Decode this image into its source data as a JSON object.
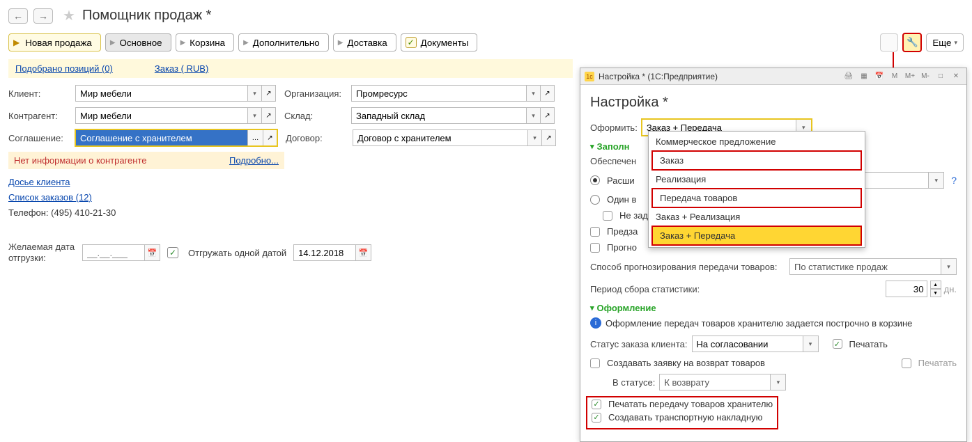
{
  "page": {
    "title": "Помощник продаж *"
  },
  "tabs": {
    "new_sale": "Новая продажа",
    "main": "Основное",
    "cart": "Корзина",
    "extra": "Дополнительно",
    "delivery": "Доставка",
    "docs": "Документы",
    "more": "Еще"
  },
  "info_strip": {
    "positions": "Подобрано позиций (0)",
    "order": "Заказ ( RUB)"
  },
  "form": {
    "client_lbl": "Клиент:",
    "client_val": "Мир мебели",
    "contr_lbl": "Контрагент:",
    "contr_val": "Мир мебели",
    "agr_lbl": "Соглашение:",
    "agr_val": "Соглашение с хранителем",
    "org_lbl": "Организация:",
    "org_val": "Промресурс",
    "wh_lbl": "Склад:",
    "wh_val": "Западный склад",
    "contract_lbl": "Договор:",
    "contract_val": "Договор с хранителем"
  },
  "warn": {
    "text": "Нет информации о контрагенте",
    "more": "Подробно..."
  },
  "links": {
    "dossier": "Досье клиента",
    "orders": "Список заказов (12)",
    "phone": "Телефон: (495) 410-21-30"
  },
  "dates": {
    "wanted_lbl": "Желаемая дата отгрузки:",
    "wanted_val": "__.__.___",
    "ship_one_lbl": "Отгружать одной датой",
    "ship_date_val": "14.12.2018"
  },
  "modal": {
    "wnd_title": "Настройка * (1С:Предприятие)",
    "h1": "Настройка *",
    "oformit_lbl": "Оформить:",
    "oformit_val": "Заказ + Передача",
    "sec_fill": "Заполн",
    "obesp_lbl": "Обеспечен",
    "rad_ext": "Расши",
    "rad_one": "Один в",
    "chk_nozad": "Не зад",
    "chk_predz": "Предза",
    "chk_progn": "Прогно",
    "forecast_lbl": "Способ прогнозирования передачи товаров:",
    "forecast_val": "По статистике продаж",
    "period_lbl": "Период сбора статистики:",
    "period_val": "30",
    "period_unit": "дн.",
    "sec_design": "Оформление",
    "info_text": "Оформление передач товаров хранителю задается построчно в корзине",
    "status_lbl": "Статус заказа клиента:",
    "status_val": "На согласовании",
    "print_lbl": "Печатать",
    "return_req": "Создавать заявку на возврат товаров",
    "print2": "Печатать",
    "in_status_lbl": "В статусе:",
    "in_status_val": "К возврату",
    "print_transfer": "Печатать передачу товаров хранителю",
    "create_waybill": "Создавать транспортную накладную"
  },
  "dropdown": {
    "items": [
      "Коммерческое предложение",
      "Заказ",
      "Реализация",
      "Передача товаров",
      "Заказ + Реализация",
      "Заказ + Передача"
    ]
  },
  "wnd_icons": {
    "m": "M",
    "mp": "M+",
    "mm": "M-"
  }
}
